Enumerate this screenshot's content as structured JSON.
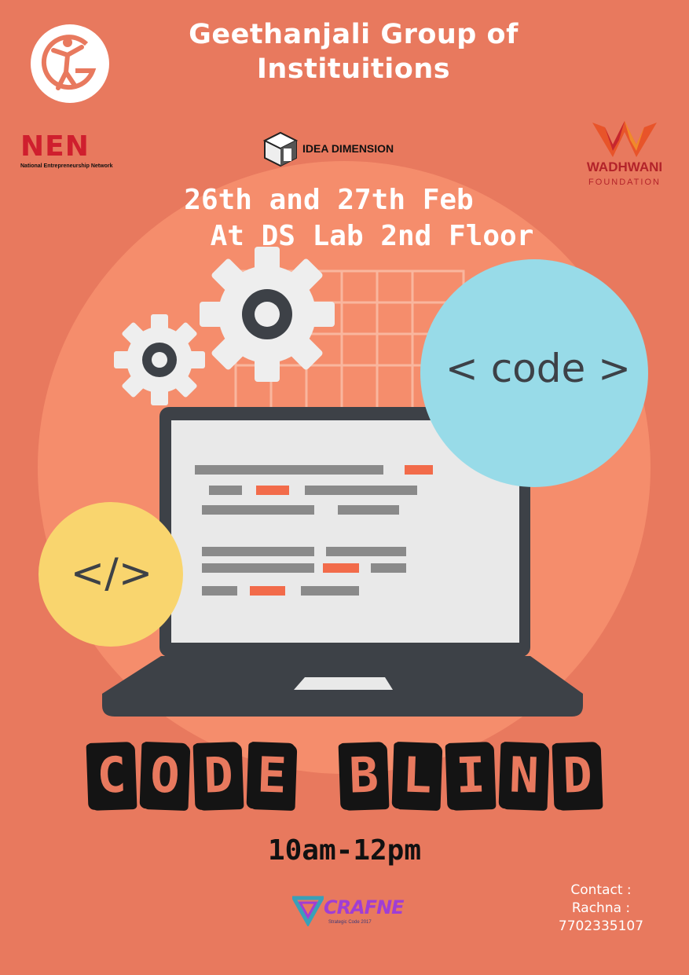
{
  "header": {
    "title_line1": "Geethanjali Group of",
    "title_line2": "Instituitions"
  },
  "logos": {
    "nen": {
      "letters": "NEN",
      "subtitle": "National Entrepreneurship Network"
    },
    "idea_dimension": {
      "text": "IDEA DIMENSION"
    },
    "wadhwani": {
      "name": "WADHWANI",
      "subtitle": "FOUNDATION"
    },
    "crafne": {
      "text": "CRAFNE",
      "subtitle": "Strategic Code 2017"
    }
  },
  "event": {
    "date": "26th and 27th Feb",
    "venue": "At DS Lab 2nd Floor",
    "name_word1": "CODE",
    "name_word2": "BLIND",
    "time": "10am-12pm"
  },
  "illustration": {
    "code_bubble": "< code >",
    "tag_bubble": "</>"
  },
  "contact": {
    "label": "Contact :",
    "name": "Rachna :",
    "phone": "7702335107"
  },
  "colors": {
    "background": "#e8795e",
    "inner_circle": "#f58d6c",
    "laptop_dark": "#3d4147",
    "screen": "#e9e9e9",
    "code_bubble": "#98dbe8",
    "tag_bubble": "#f9d56e",
    "accent_line": "#f26b4a"
  }
}
